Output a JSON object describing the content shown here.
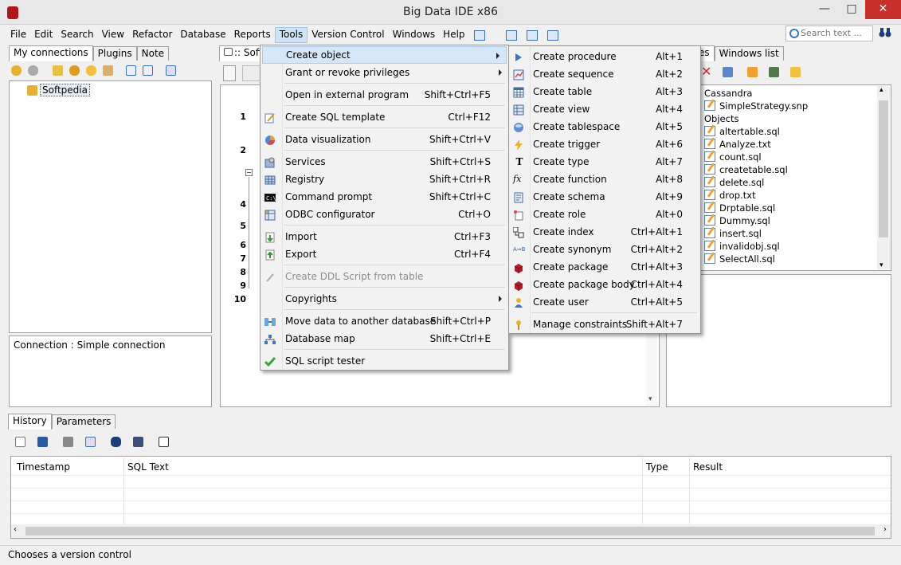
{
  "window": {
    "title": "Big Data IDE x86",
    "minimize": "—",
    "maximize": "□",
    "close": "✕"
  },
  "menubar": {
    "items": [
      {
        "label": "File"
      },
      {
        "label": "Edit"
      },
      {
        "label": "Search"
      },
      {
        "label": "View"
      },
      {
        "label": "Refactor"
      },
      {
        "label": "Database"
      },
      {
        "label": "Reports"
      },
      {
        "label": "Tools",
        "active": true
      },
      {
        "label": "Version Control"
      },
      {
        "label": "Windows"
      },
      {
        "label": "Help"
      }
    ]
  },
  "search": {
    "placeholder": "Search text ..."
  },
  "left_panel": {
    "tabs": [
      {
        "label": "My connections"
      },
      {
        "label": "Plugins"
      },
      {
        "label": "Note"
      }
    ],
    "tree": [
      {
        "label": "Softpedia"
      }
    ],
    "connection_info": "Connection : Simple connection"
  },
  "editor": {
    "tab_label": ":: Soft",
    "line_numbers": [
      "1",
      "2",
      "4",
      "5",
      "6",
      "7",
      "8",
      "9",
      "10"
    ]
  },
  "right_panel": {
    "tabs": [
      {
        "label": "es"
      },
      {
        "label": "Windows list"
      }
    ],
    "items": [
      "Cassandra",
      "SimpleStrategy.snp",
      "Objects",
      "altertable.sql",
      "Analyze.txt",
      "count.sql",
      "createtable.sql",
      "delete.sql",
      "drop.txt",
      "Drptable.sql",
      "Dummy.sql",
      "insert.sql",
      "invalidobj.sql",
      "SelectAll.sql"
    ]
  },
  "tools_menu": {
    "items": [
      {
        "label": "Create object",
        "shortcut": "",
        "submenu": true,
        "icon": "create-object-icon",
        "highlighted": true
      },
      {
        "label": "Grant or revoke privileges",
        "shortcut": "",
        "submenu": true,
        "icon": ""
      },
      {
        "label": "Open in external program",
        "shortcut": "Shift+Ctrl+F5",
        "icon": ""
      },
      {
        "label": "Create SQL template",
        "shortcut": "Ctrl+F12",
        "icon": "template-icon"
      },
      {
        "label": "Data visualization",
        "shortcut": "Shift+Ctrl+V",
        "icon": "pie-chart-icon"
      },
      {
        "label": "Services",
        "shortcut": "Shift+Ctrl+S",
        "icon": "services-icon"
      },
      {
        "label": "Registry",
        "shortcut": "Shift+Ctrl+R",
        "icon": "registry-icon"
      },
      {
        "label": "Command prompt",
        "shortcut": "Shift+Ctrl+C",
        "icon": "command-prompt-icon"
      },
      {
        "label": "ODBC configurator",
        "shortcut": "Ctrl+O",
        "icon": "odbc-icon"
      },
      {
        "label": "Import",
        "shortcut": "Ctrl+F3",
        "icon": "import-icon"
      },
      {
        "label": "Export",
        "shortcut": "Ctrl+F4",
        "icon": "export-icon"
      },
      {
        "label": "Create DDL Script from table",
        "shortcut": "",
        "icon": "ddl-icon",
        "disabled": true
      },
      {
        "label": "Copyrights",
        "shortcut": "",
        "submenu": true,
        "icon": ""
      },
      {
        "label": "Move data to another database",
        "shortcut": "Shift+Ctrl+P",
        "icon": "move-data-icon"
      },
      {
        "label": "Database map",
        "shortcut": "Shift+Ctrl+E",
        "icon": "database-map-icon"
      },
      {
        "label": "SQL script tester",
        "shortcut": "",
        "icon": "check-icon"
      }
    ]
  },
  "create_object_menu": {
    "items": [
      {
        "label": "Create procedure",
        "shortcut": "Alt+1",
        "icon": "procedure-icon"
      },
      {
        "label": "Create sequence",
        "shortcut": "Alt+2",
        "icon": "sequence-icon"
      },
      {
        "label": "Create table",
        "shortcut": "Alt+3",
        "icon": "table-icon"
      },
      {
        "label": "Create view",
        "shortcut": "Alt+4",
        "icon": "view-icon"
      },
      {
        "label": "Create tablespace",
        "shortcut": "Alt+5",
        "icon": "tablespace-icon"
      },
      {
        "label": "Create trigger",
        "shortcut": "Alt+6",
        "icon": "trigger-icon"
      },
      {
        "label": "Create type",
        "shortcut": "Alt+7",
        "icon": "type-icon"
      },
      {
        "label": "Create function",
        "shortcut": "Alt+8",
        "icon": "function-icon"
      },
      {
        "label": "Create schema",
        "shortcut": "Alt+9",
        "icon": "schema-icon"
      },
      {
        "label": "Create role",
        "shortcut": "Alt+0",
        "icon": "role-icon"
      },
      {
        "label": "Create index",
        "shortcut": "Ctrl+Alt+1",
        "icon": "index-icon"
      },
      {
        "label": "Create synonym",
        "shortcut": "Ctrl+Alt+2",
        "icon": "synonym-icon"
      },
      {
        "label": "Create package",
        "shortcut": "Ctrl+Alt+3",
        "icon": "package-icon"
      },
      {
        "label": "Create package body",
        "shortcut": "Ctrl+Alt+4",
        "icon": "package-body-icon"
      },
      {
        "label": "Create user",
        "shortcut": "Ctrl+Alt+5",
        "icon": "user-icon"
      },
      {
        "label": "Manage constraints",
        "shortcut": "Shift+Alt+7",
        "icon": "key-icon"
      }
    ]
  },
  "bottom_panel": {
    "tabs": [
      {
        "label": "History"
      },
      {
        "label": "Parameters"
      }
    ],
    "columns": [
      "Timestamp",
      "SQL Text",
      "Type",
      "Result"
    ]
  },
  "status": {
    "text": "Chooses a version control"
  }
}
